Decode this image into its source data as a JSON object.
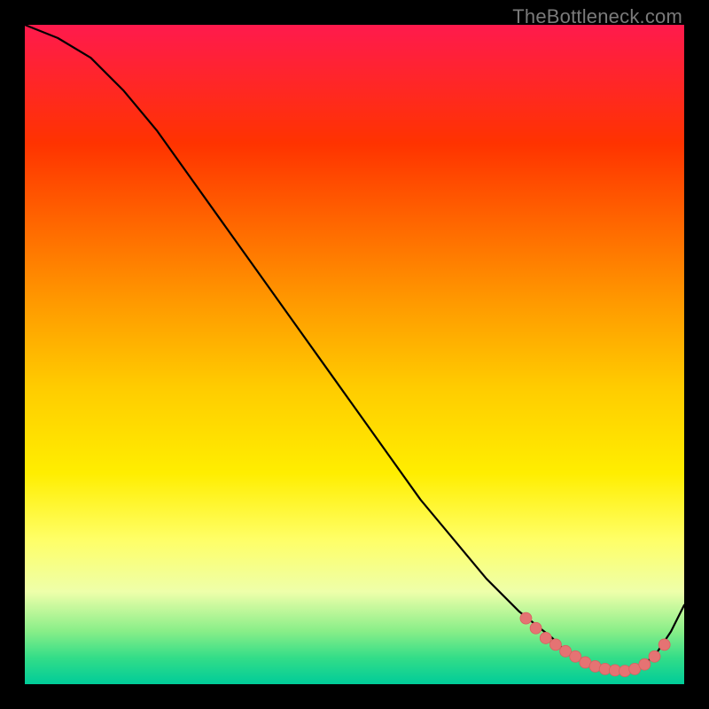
{
  "watermark": "TheBottleneck.com",
  "colors": {
    "curve_stroke": "#000000",
    "marker_fill": "#e57373",
    "marker_stroke": "#d86060",
    "background": "#000000"
  },
  "chart_data": {
    "type": "line",
    "title": "",
    "xlabel": "",
    "ylabel": "",
    "xlim": [
      0,
      100
    ],
    "ylim": [
      0,
      100
    ],
    "series": [
      {
        "name": "curve",
        "x": [
          0,
          5,
          10,
          15,
          20,
          25,
          30,
          35,
          40,
          45,
          50,
          55,
          60,
          65,
          70,
          75,
          80,
          82,
          84,
          86,
          88,
          90,
          92,
          94,
          96,
          98,
          100
        ],
        "y": [
          100,
          98,
          95,
          90,
          84,
          77,
          70,
          63,
          56,
          49,
          42,
          35,
          28,
          22,
          16,
          11,
          7,
          5,
          4,
          3,
          2,
          2,
          2,
          3,
          5,
          8,
          12
        ]
      }
    ],
    "markers": [
      {
        "x": 76,
        "y": 10
      },
      {
        "x": 77.5,
        "y": 8.5
      },
      {
        "x": 79,
        "y": 7
      },
      {
        "x": 80.5,
        "y": 6
      },
      {
        "x": 82,
        "y": 5
      },
      {
        "x": 83.5,
        "y": 4.2
      },
      {
        "x": 85,
        "y": 3.3
      },
      {
        "x": 86.5,
        "y": 2.7
      },
      {
        "x": 88,
        "y": 2.3
      },
      {
        "x": 89.5,
        "y": 2.1
      },
      {
        "x": 91,
        "y": 2.0
      },
      {
        "x": 92.5,
        "y": 2.3
      },
      {
        "x": 94,
        "y": 3.0
      },
      {
        "x": 95.5,
        "y": 4.2
      },
      {
        "x": 97,
        "y": 6.0
      }
    ]
  }
}
